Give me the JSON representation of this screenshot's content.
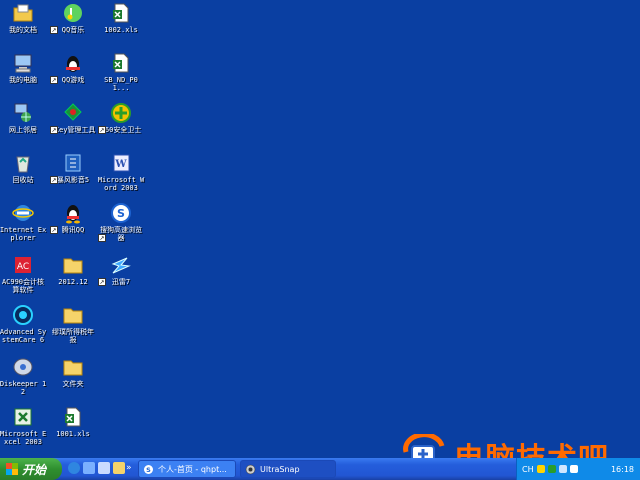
{
  "desktop_icons": [
    {
      "label": "我的文档",
      "icon": "folder-icon"
    },
    {
      "label": "QQ音乐",
      "icon": "qq-music-icon"
    },
    {
      "label": "1002.xls",
      "icon": "excel-file-icon"
    },
    {
      "label": "我的电脑",
      "icon": "computer-icon"
    },
    {
      "label": "QQ游戏",
      "icon": "qq-game-icon"
    },
    {
      "label": "SB_ND_P01...",
      "icon": "excel-file-icon"
    },
    {
      "label": "网上邻居",
      "icon": "network-icon"
    },
    {
      "label": "UKey管理工具",
      "icon": "ukey-icon"
    },
    {
      "label": "360安全卫士",
      "icon": "360-security-icon"
    },
    {
      "label": "回收站",
      "icon": "recycle-bin-icon"
    },
    {
      "label": "暴风影音5",
      "icon": "media-player-icon"
    },
    {
      "label": "Microsoft Word 2003",
      "icon": "word-icon"
    },
    {
      "label": "Internet Explorer",
      "icon": "ie-icon"
    },
    {
      "label": "腾讯QQ",
      "icon": "qq-penguin-icon"
    },
    {
      "label": "搜狗高速浏览器",
      "icon": "sogou-browser-icon"
    },
    {
      "label": "AC990会计核算软件",
      "icon": "accounting-software-icon"
    },
    {
      "label": "2012.12",
      "icon": "folder-icon"
    },
    {
      "label": "迅雷7",
      "icon": "thunder-icon"
    },
    {
      "label": "Advanced SystemCare 6",
      "icon": "systemcare-icon"
    },
    {
      "label": "缪璞所得税年报",
      "icon": "folder-icon"
    },
    {
      "label": "Diskeeper 12",
      "icon": "diskeeper-icon"
    },
    {
      "label": "文件夹",
      "icon": "folder-icon"
    },
    {
      "label": "Microsoft Excel 2003",
      "icon": "excel-icon"
    },
    {
      "label": "1001.xls",
      "icon": "excel-file-icon"
    }
  ],
  "taskbar": {
    "start_label": "开始",
    "tasks": [
      {
        "label": "个人-首页 - qhpt...",
        "icon": "sogou-browser-icon"
      },
      {
        "label": "UltraSnap",
        "icon": "camera-icon"
      }
    ],
    "tray": {
      "lang": "CH",
      "clock": "16:18"
    }
  },
  "watermark": {
    "text": "电脑技术吧"
  },
  "colors": {
    "desktop": "#0a3fa2",
    "taskbar": "#245edc",
    "start": "#2f8f2f",
    "watermark": "#ff6a00"
  }
}
